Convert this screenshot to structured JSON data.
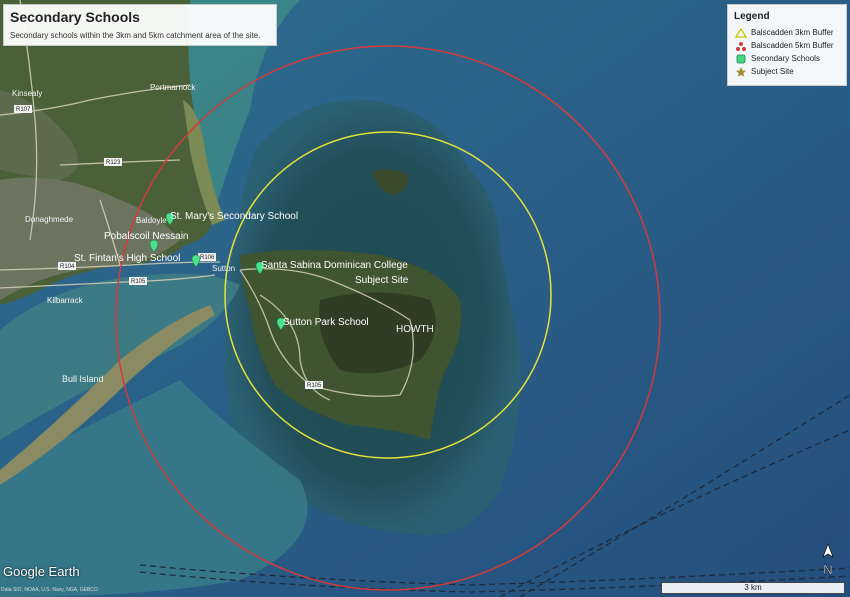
{
  "title": "Secondary Schools",
  "subtitle": "Secondary schools within the 3km and 5km catchment area of the site.",
  "legend": {
    "title": "Legend",
    "items": [
      {
        "label": "Balscadden 3km Buffer",
        "color": "#c9c400"
      },
      {
        "label": "Balscadden 5km Buffer",
        "color": "#d43a3a"
      },
      {
        "label": "Secondary Schools",
        "color": "#3ddc84"
      },
      {
        "label": "Subject Site",
        "color": "#a38b33"
      }
    ]
  },
  "schools": [
    {
      "name": "St. Mary's Secondary School"
    },
    {
      "name": "Pobalscoil Nessain"
    },
    {
      "name": "St. Fintan's High School"
    },
    {
      "name": "Santa Sabina Dominican College"
    },
    {
      "name": "Sutton Park School"
    }
  ],
  "subject_site": {
    "label": "Subject Site"
  },
  "place_labels": {
    "kinsealy": "Kinsealy",
    "portmarnock": "Portmarnock",
    "donaghmede": "Donaghmede",
    "baldoyle": "Baldoyle",
    "sutton": "Sutton",
    "kilbarrack": "Kilbarrack",
    "bull_island": "Bull Island",
    "howth": "HOWTH"
  },
  "road_labels": {
    "r107": "R107",
    "r123": "R123",
    "r106": "R106",
    "r104": "R104",
    "r105_west": "R105",
    "r105_howth": "R105"
  },
  "branding": {
    "google_earth": "Google Earth",
    "credits": "Data SIO, NOAA, U.S. Navy, NGA, GEBCO"
  },
  "scale_bar": {
    "label": "3 km"
  },
  "north_arrow": {
    "label": "N"
  }
}
